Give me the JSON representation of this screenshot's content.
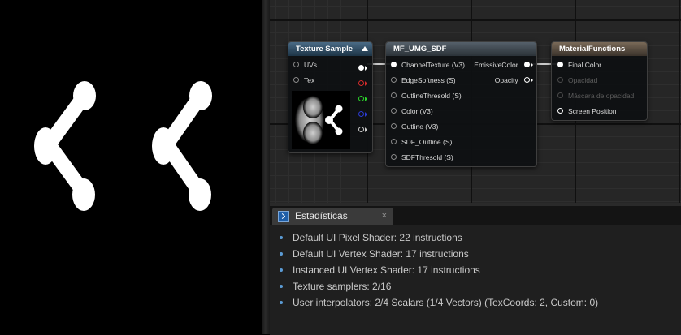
{
  "preview": {
    "background": "#000000",
    "foreground": "#ffffff"
  },
  "nodes": {
    "texture_sample": {
      "title": "Texture Sample",
      "inputs": [
        "UVs",
        "Tex"
      ],
      "output_colors": [
        "#ffffff",
        "#d42b2b",
        "#2bd42b",
        "#2b3bd4",
        "#cccccc"
      ]
    },
    "mf_umg_sdf": {
      "title": "MF_UMG_SDF",
      "inputs": [
        "ChannelTexture (V3)",
        "EdgeSoftness (S)",
        "OutlineThresold (S)",
        "Color (V3)",
        "Outline (V3)",
        "SDF_Outline (S)",
        "SDFThresold (S)"
      ],
      "outputs": [
        "EmissiveColor",
        "Opacity"
      ]
    },
    "material_functions": {
      "title": "MaterialFunctions",
      "inputs": [
        {
          "label": "Final Color",
          "enabled": true
        },
        {
          "label": "Opacidad",
          "enabled": false
        },
        {
          "label": "Máscara de opacidad",
          "enabled": false
        },
        {
          "label": "Screen Position",
          "enabled": true
        }
      ]
    }
  },
  "stats": {
    "tab_label": "Estadísticas",
    "tab_close": "×",
    "lines": [
      "Default UI Pixel Shader: 22 instructions",
      "Default UI Vertex Shader: 17 instructions",
      "Instanced UI Vertex Shader: 17 instructions",
      "Texture samplers: 2/16",
      "User interpolators: 2/4 Scalars (1/4 Vectors) (TexCoords: 2, Custom: 0)"
    ]
  },
  "colors": {
    "graph_bg": "#262626",
    "panel_bg": "#1f1f1f",
    "accent": "#5b9bd5"
  }
}
